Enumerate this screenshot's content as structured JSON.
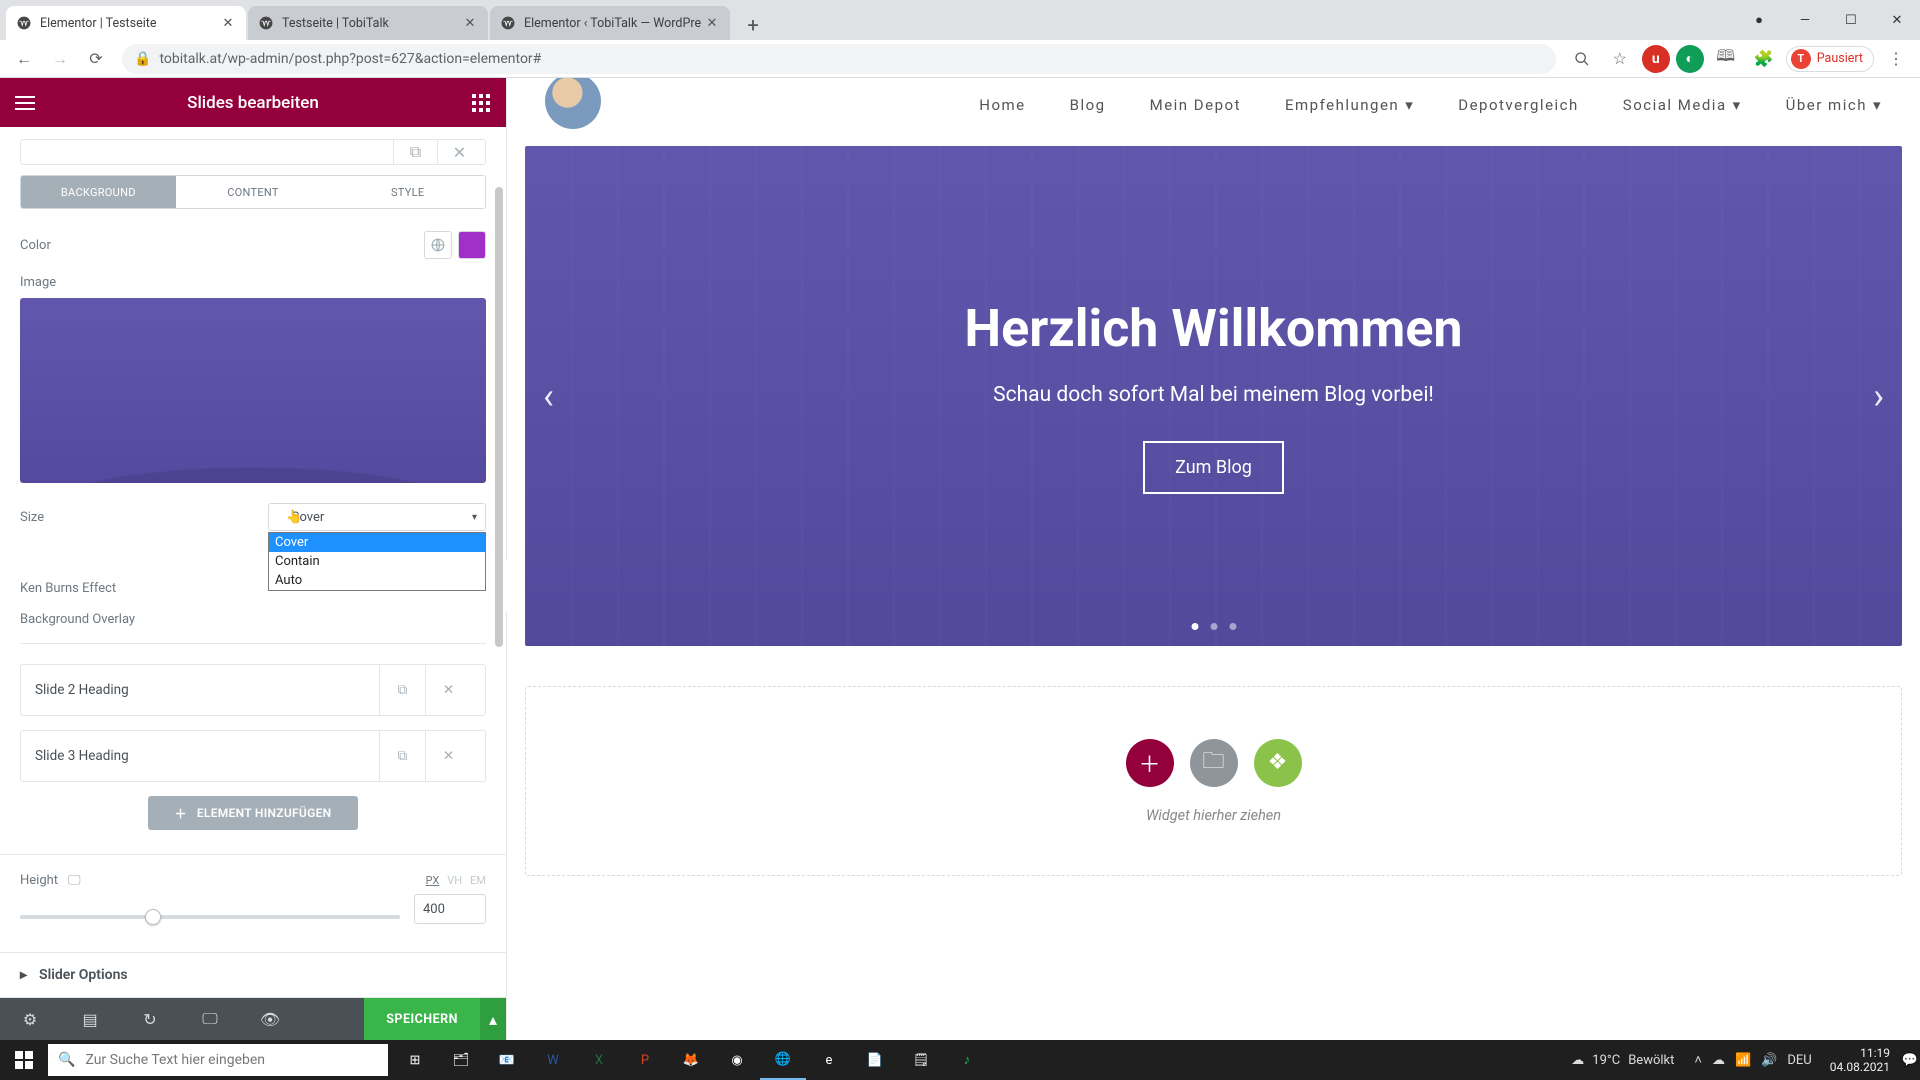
{
  "browser": {
    "tabs": [
      {
        "title": "Elementor | Testseite",
        "active": true
      },
      {
        "title": "Testseite | TobiTalk",
        "active": false
      },
      {
        "title": "Elementor ‹ TobiTalk — WordPre",
        "active": false
      }
    ],
    "url": "tobitalk.at/wp-admin/post.php?post=627&action=elementor#",
    "paused_label": "Pausiert",
    "avatar_initial": "T"
  },
  "panel": {
    "title": "Slides bearbeiten",
    "tabs": {
      "background": "BACKGROUND",
      "content": "CONTENT",
      "style": "STYLE"
    },
    "color_label": "Color",
    "color_value": "#a030c8",
    "image_label": "Image",
    "size_label": "Size",
    "size_value": "Cover",
    "size_options": [
      "Cover",
      "Contain",
      "Auto"
    ],
    "ken_burns_label": "Ken Burns Effect",
    "overlay_label": "Background Overlay",
    "slides": [
      {
        "label": "Slide 2 Heading"
      },
      {
        "label": "Slide 3 Heading"
      }
    ],
    "add_button": "ELEMENT HINZUFÜGEN",
    "height_label": "Height",
    "height_units": {
      "px": "PX",
      "vh": "VH",
      "em": "EM"
    },
    "height_value": "400",
    "slider_options": "Slider Options",
    "save": "SPEICHERN"
  },
  "site": {
    "nav": {
      "home": "Home",
      "blog": "Blog",
      "depot": "Mein Depot",
      "empfehlungen": "Empfehlungen",
      "depotvergleich": "Depotvergleich",
      "social": "Social Media",
      "ueber": "Über mich"
    },
    "hero": {
      "title": "Herzlich Willkommen",
      "subtitle": "Schau doch sofort Mal bei meinem Blog vorbei!",
      "button": "Zum Blog"
    },
    "dropzone": "Widget hierher ziehen"
  },
  "taskbar": {
    "search_placeholder": "Zur Suche Text hier eingeben",
    "weather_temp": "19°C",
    "weather_cond": "Bewölkt",
    "lang": "DEU",
    "time": "11:19",
    "date": "04.08.2021"
  }
}
